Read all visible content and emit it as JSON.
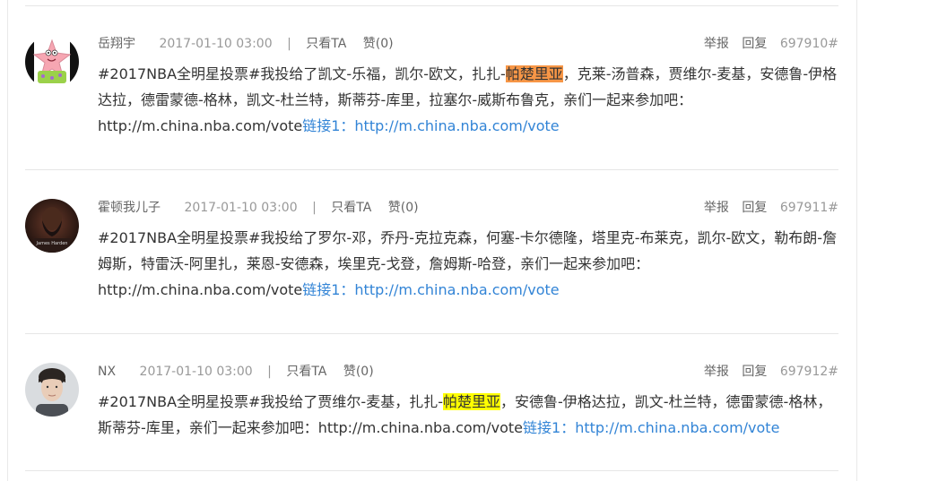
{
  "comments": [
    {
      "user": "岳翔宇",
      "time": "2017-01-10 03:00",
      "separator": "|",
      "only_see": "只看TA",
      "like": "赞(0)",
      "report": "举报",
      "reply": "回复",
      "floor": "697910#",
      "text_before": "#2017NBA全明星投票#我投给了凯文-乐福，凯尔-欧文，扎扎-",
      "highlight": "帕楚里亚",
      "highlight_color": "#f79646",
      "text_after": "，克莱-汤普森，贾维尔-麦基，安德鲁-伊格达拉，德雷蒙德-格林，凯文-杜兰特，斯蒂芬-库里，拉塞尔-威斯布鲁克，亲们一起来参加吧：http://m.china.nba.com/vote",
      "link": "链接1：http://m.china.nba.com/vote"
    },
    {
      "user": "霍顿我儿子",
      "time": "2017-01-10 03:00",
      "separator": "|",
      "only_see": "只看TA",
      "like": "赞(0)",
      "report": "举报",
      "reply": "回复",
      "floor": "697911#",
      "text": "#2017NBA全明星投票#我投给了罗尔-邓，乔丹-克拉克森，何塞-卡尔德隆，塔里克-布莱克，凯尔-欧文，勒布朗-詹姆斯，特雷沃-阿里扎，莱恩-安德森，埃里克-戈登，詹姆斯-哈登，亲们一起来参加吧：http://m.china.nba.com/vote",
      "link": "链接1：http://m.china.nba.com/vote",
      "avatar_text": "James Harden"
    },
    {
      "user": "NX",
      "time": "2017-01-10 03:00",
      "separator": "|",
      "only_see": "只看TA",
      "like": "赞(0)",
      "report": "举报",
      "reply": "回复",
      "floor": "697912#",
      "text_before": "#2017NBA全明星投票#我投给了贾维尔-麦基，扎扎-",
      "highlight": "帕楚里亚",
      "highlight_color": "#ffff00",
      "text_after": "，安德鲁-伊格达拉，凯文-杜兰特，德雷蒙德-格林，斯蒂芬-库里，亲们一起来参加吧：http://m.china.nba.com/vote",
      "link": "链接1：http://m.china.nba.com/vote"
    }
  ],
  "colors": {
    "link": "#3284d6",
    "text": "#333333",
    "meta": "#999999",
    "divider": "#e6e6e6"
  }
}
